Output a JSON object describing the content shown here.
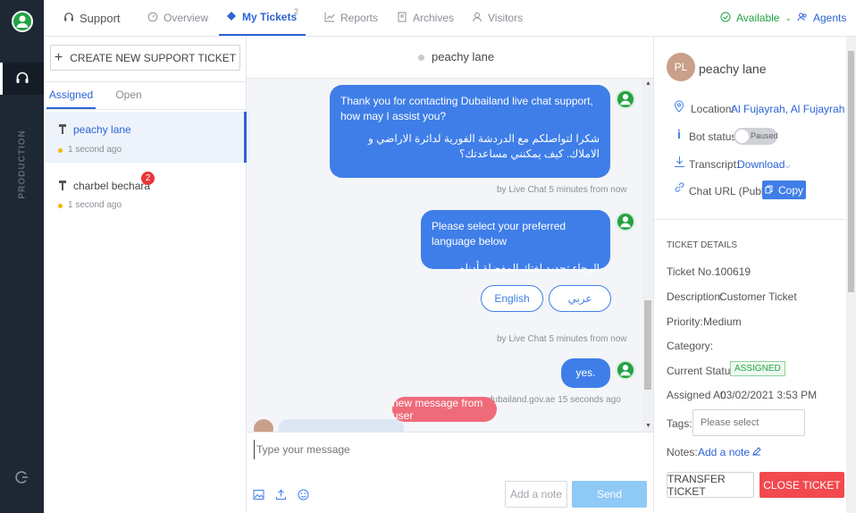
{
  "nav": {
    "brand": "Support",
    "tabs": [
      {
        "label": "Overview"
      },
      {
        "label": "My Tickets",
        "count": "2"
      },
      {
        "label": "Reports"
      },
      {
        "label": "Archives"
      },
      {
        "label": "Visitors"
      }
    ],
    "status": "Available",
    "agents": "Agents"
  },
  "rail": {
    "env_label": "PRODUCTION"
  },
  "left": {
    "create_button": "CREATE NEW SUPPORT TICKET",
    "subtabs": [
      "Assigned",
      "Open"
    ],
    "tickets": [
      {
        "name": "peachy lane",
        "time": "1 second ago",
        "badge": ""
      },
      {
        "name": "charbel bechara",
        "time": "1 second ago",
        "badge": "2"
      }
    ]
  },
  "chat": {
    "header_name": "peachy lane",
    "messages": [
      {
        "text_en": "Thank you for contacting Dubailand live chat support,  how may I assist you?",
        "text_ar": "شكرا لتواصلكم مع الدردشة الفورية لدائرة الاراضي و الاملاك. كيف يمكنني مساعدتك؟",
        "meta": "by Live Chat  5 minutes from now"
      },
      {
        "text_en": "Please select your preferred language below",
        "text_ar": "الرجاء تحديد لغتك المفضلة أدناه",
        "meta": "by Live Chat  5 minutes from now"
      },
      {
        "text_en": "yes.",
        "meta": "dubailand.gov.ae  15 seconds ago"
      }
    ],
    "lang_options": [
      "English",
      "عربي"
    ],
    "toast": "new message from user",
    "input_placeholder": "Type your message",
    "add_note": "Add a note",
    "send": "Send"
  },
  "details": {
    "initials": "PL",
    "name": "peachy lane",
    "location_label": "Location:",
    "location_value": "Al Fujayrah, Al Fujayrah",
    "bot_label": "Bot status:",
    "bot_value": "Paused",
    "transcript_label": "Transcript:",
    "transcript_value": "Download",
    "url_label": "Chat URL (Public):",
    "copy": "Copy",
    "section_title": "TICKET DETAILS",
    "ticket_no_label": "Ticket No.:",
    "ticket_no": "100619",
    "description_label": "Description:",
    "description": "Customer Ticket",
    "priority_label": "Priority:",
    "priority": "Medium",
    "category_label": "Category:",
    "status_label": "Current Status:",
    "status": "ASSIGNED",
    "assigned_label": "Assigned At:",
    "assigned_at": "03/02/2021 3:53 PM",
    "tags_label": "Tags:",
    "tags_placeholder": "Please select",
    "notes_label": "Notes:",
    "add_note": "Add a note",
    "transfer": "TRANSFER TICKET",
    "close": "CLOSE TICKET"
  },
  "colors": {
    "accent": "#2c63d6",
    "bubble": "#3f7ee8",
    "danger": "#f2494e",
    "success": "#25a244",
    "rail": "#1e2734"
  }
}
